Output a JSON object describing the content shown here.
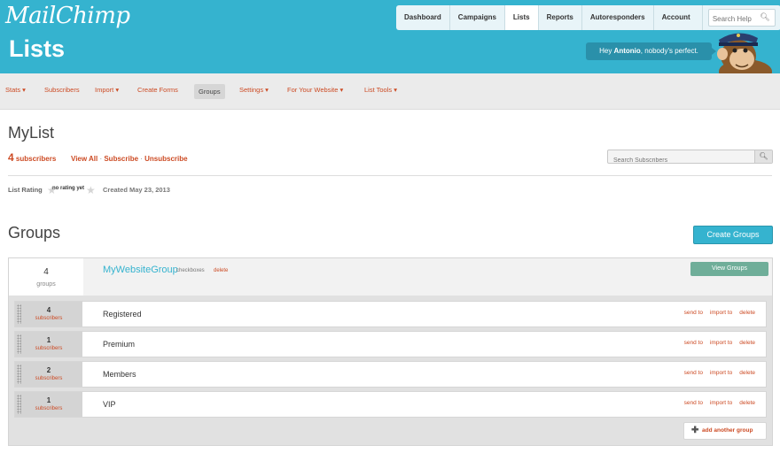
{
  "app": {
    "logo": "MailChimp",
    "page_title": "Lists"
  },
  "nav": {
    "items": [
      "Dashboard",
      "Campaigns",
      "Lists",
      "Reports",
      "Autoresponders",
      "Account ▾"
    ],
    "search_placeholder": "Search Help"
  },
  "greeting": {
    "prefix": "Hey ",
    "name": "Antonio",
    "suffix": ", nobody's perfect."
  },
  "subnav": {
    "items": [
      "Stats ▾",
      "Subscribers",
      "Import ▾",
      "Create Forms",
      "Groups",
      "Settings ▾",
      "For Your Website ▾",
      "List Tools ▾"
    ],
    "active": "Groups"
  },
  "list": {
    "name": "MyList",
    "subscriber_count": "4",
    "subscriber_label": " subscribers",
    "view_all": "View All",
    "subscribe": "Subscribe",
    "unsubscribe": "Unsubscribe",
    "sep": " · ",
    "search_placeholder": "Search Subscribers",
    "rating_label": "List Rating",
    "rating_value": "no rating yet",
    "created": "Created May 23, 2013"
  },
  "groups": {
    "title": "Groups",
    "create_button": "Create Groups",
    "group": {
      "count": "4",
      "count_label": "groups",
      "name": "MyWebsiteGroup",
      "type": "checkboxes",
      "delete": "delete",
      "view_button": "View Groups"
    },
    "rows": [
      {
        "count": "4",
        "label": "subscribers",
        "name": "Registered"
      },
      {
        "count": "1",
        "label": "subscribers",
        "name": "Premium"
      },
      {
        "count": "2",
        "label": "subscribers",
        "name": "Members"
      },
      {
        "count": "1",
        "label": "subscribers",
        "name": "VIP"
      }
    ],
    "row_actions": {
      "send": "send to",
      "import": "import to",
      "delete": "delete"
    },
    "add_button": "add another group"
  },
  "colors": {
    "header": "#35b3cf",
    "accent": "#cc4a23",
    "view_button": "#6fae99"
  }
}
